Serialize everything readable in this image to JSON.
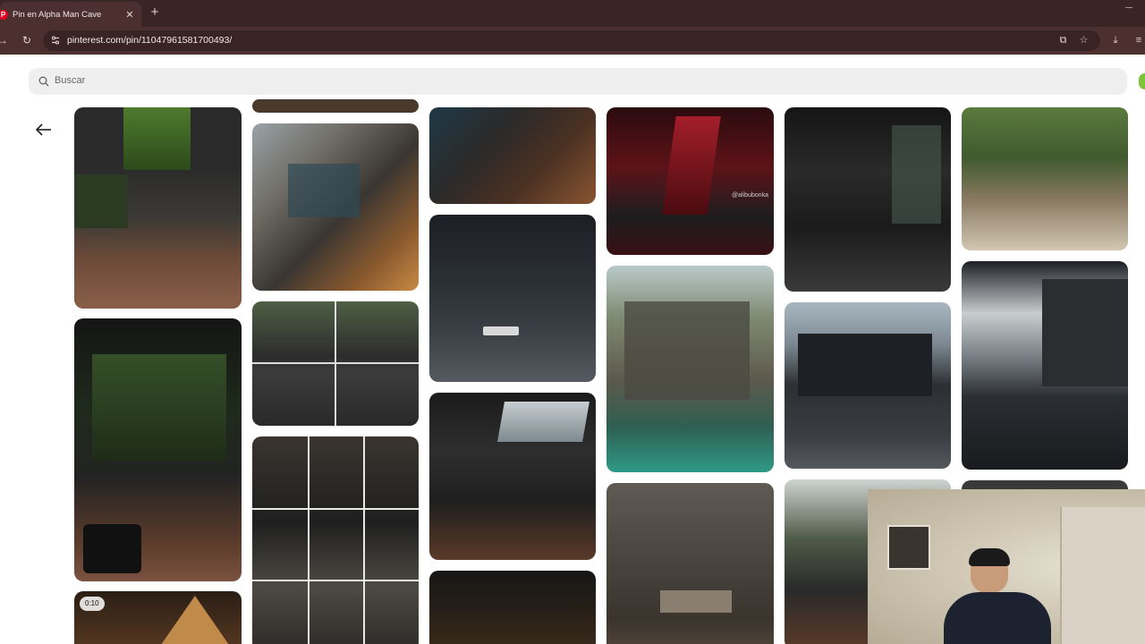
{
  "browser": {
    "tab_title": "Pin en Alpha Man Cave",
    "favicon_letter": "P",
    "close_glyph": "✕",
    "newtab_glyph": "+",
    "url": "pinterest.com/pin/11047961581700493/"
  },
  "search": {
    "placeholder": "Buscar"
  },
  "pins": [
    {
      "badge": ""
    },
    {
      "badge": ""
    },
    {
      "badge": "0:10"
    }
  ],
  "watermark": "@alibubonka",
  "colors": {
    "tabbar": "#3b2424",
    "toolbar": "#4c302f",
    "accent": "#7ec23a"
  }
}
